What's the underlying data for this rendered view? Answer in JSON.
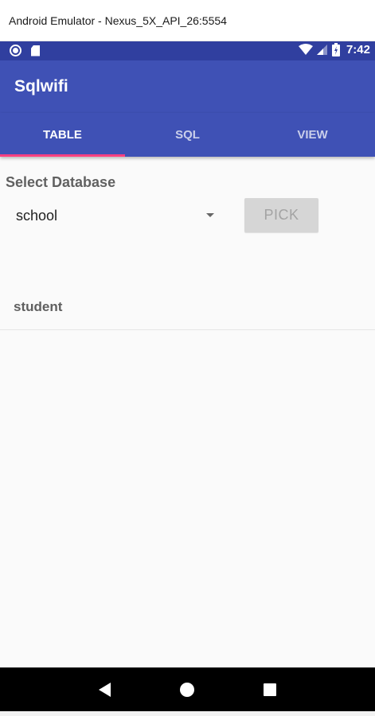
{
  "window": {
    "title": "Android Emulator - Nexus_5X_API_26:5554"
  },
  "status_bar": {
    "time": "7:42",
    "left_icons": [
      "record-circle-icon",
      "sd-card-icon"
    ],
    "right_icons": [
      "wifi-icon",
      "cell-signal-icon",
      "battery-icon"
    ]
  },
  "app_bar": {
    "title": "Sqlwifi"
  },
  "tabs": [
    {
      "label": "TABLE",
      "active": true
    },
    {
      "label": "SQL",
      "active": false
    },
    {
      "label": "VIEW",
      "active": false
    }
  ],
  "content": {
    "select_label": "Select Database",
    "spinner_value": "school",
    "pick_button_label": "PICK",
    "tables": [
      "student"
    ]
  },
  "nav_bar": {
    "icons": [
      "back-icon",
      "home-icon",
      "recents-icon"
    ]
  },
  "colors": {
    "primary": "#3f51b5",
    "primary_dark": "#303f9f",
    "accent": "#ff4081",
    "background": "#fafafa"
  }
}
